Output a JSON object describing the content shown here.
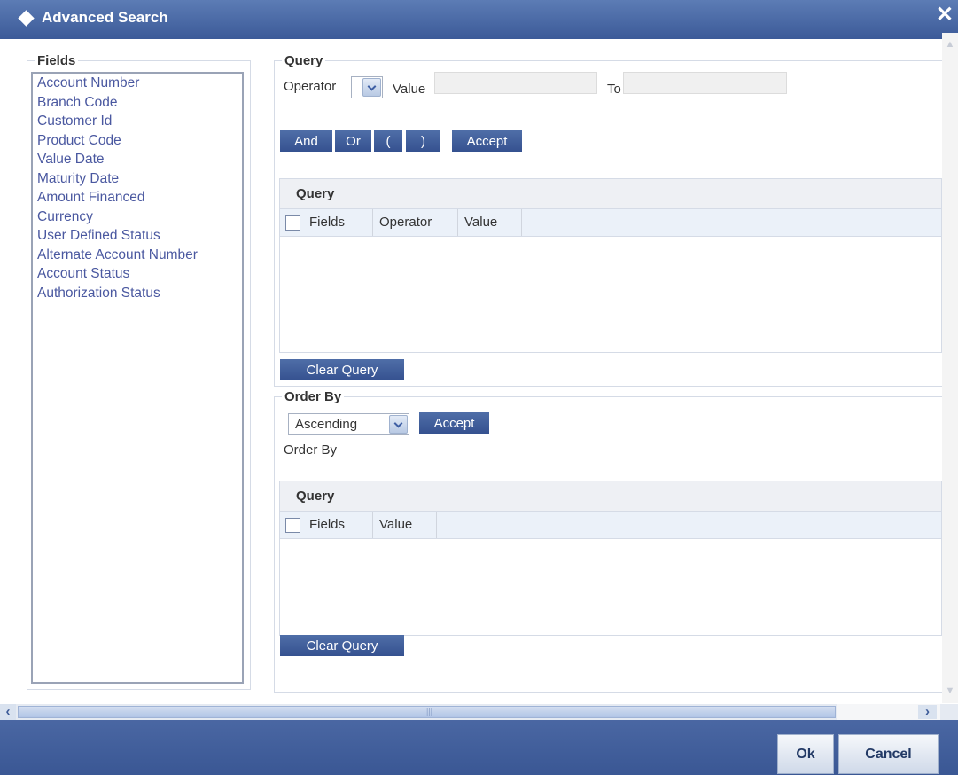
{
  "window": {
    "title": "Advanced Search"
  },
  "fields_panel": {
    "legend": "Fields",
    "items": [
      "Account Number",
      "Branch Code",
      "Customer Id",
      "Product Code",
      "Value Date",
      "Maturity Date",
      "Amount Financed",
      "Currency",
      "User Defined Status",
      "Alternate Account Number",
      "Account Status",
      "Authorization Status"
    ]
  },
  "query_panel": {
    "legend": "Query",
    "operator_label": "Operator",
    "value_label": "Value",
    "to_label": "To",
    "value_input": "",
    "to_input": "",
    "buttons": {
      "and": "And",
      "or": "Or",
      "open_paren": "(",
      "close_paren": ")",
      "accept": "Accept"
    },
    "grid": {
      "caption": "Query",
      "columns": [
        "Fields",
        "Operator",
        "Value"
      ],
      "rows": []
    },
    "clear_button": "Clear Query"
  },
  "order_panel": {
    "legend": "Order By",
    "sort_select": "Ascending",
    "accept_button": "Accept",
    "order_by_label": "Order By",
    "grid": {
      "caption": "Query",
      "columns": [
        "Fields",
        "Value"
      ],
      "rows": []
    },
    "clear_button": "Clear Query"
  },
  "footer": {
    "ok": "Ok",
    "cancel": "Cancel"
  }
}
